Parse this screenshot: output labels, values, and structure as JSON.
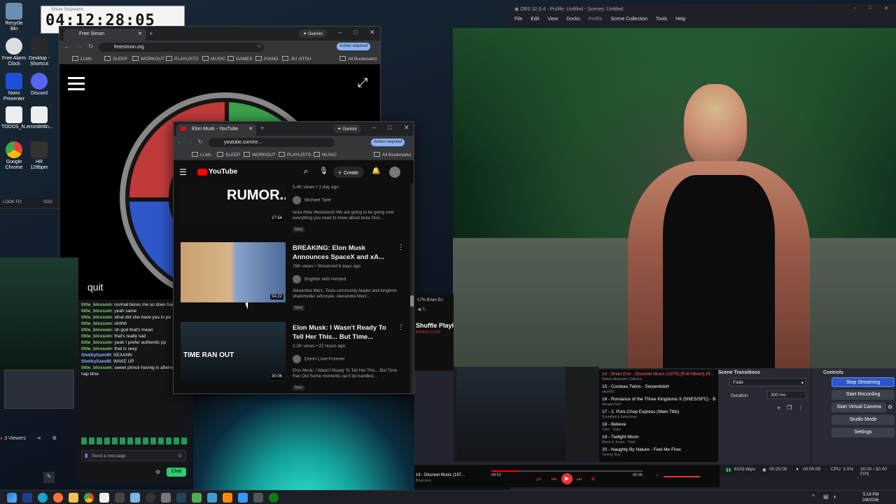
{
  "desktop": {
    "icons": [
      {
        "label": "Recycle Bin"
      },
      {
        "label": "Free Alarm Clock"
      },
      {
        "label": "Desktop - Shortcut"
      },
      {
        "label": "Nomi Presenter"
      },
      {
        "label": "Discord"
      },
      {
        "label": "TODOS_N..."
      },
      {
        "label": "errordrittin..."
      },
      {
        "label": "Google Chrome"
      },
      {
        "label": "HR 128bpm"
      }
    ],
    "clock_overlay": "04:12:28:05",
    "clock_window_title": "XNote Stopwatch"
  },
  "simon_window": {
    "tab_title": "Free Simon",
    "url": "freesimon.org",
    "gemini": "Gemini",
    "action_required": "Action required",
    "bookmarks": [
      "LLMs",
      "SLEEP",
      "WORKOUT",
      "PLAYLISTS",
      "MUSIC",
      "GAMES",
      "PIANO",
      "JIU JITSU"
    ],
    "all_bookmarks": "All Bookmarks",
    "quit_label": "quit"
  },
  "youtube_window": {
    "tab_title": "Elon Musk - YouTube",
    "url": "youtube.com/re...",
    "gemini": "Gemini",
    "action_required": "Action required",
    "bookmarks": [
      "LLMs",
      "SLEEP",
      "WORKOUT",
      "PLAYLISTS",
      "MUSIC"
    ],
    "all_bookmarks": "All Bookmarks",
    "logo": "YouTube",
    "create": "Create",
    "videos": [
      {
        "thumb_text": "RUMOR...",
        "meta": "5.4K views • 1 day ago",
        "channel": "Michael Tyler",
        "desc": "tesla #tsla #teslastock We are going to be going over everything you need to know about tesla Stoc...",
        "badge": "New",
        "duration": "27:54"
      },
      {
        "title": "BREAKING: Elon Musk Announces SpaceX and xA...",
        "meta": "76K views • Streamed 6 days ago",
        "channel": "Brighter with Herbert",
        "desc": "Alexandra Merz, Tesla community leader and longtime shareholder advocate. Alexandra Merz...",
        "badge": "New",
        "duration": "54:22"
      },
      {
        "title": "Elon Musk: I Wasn't Ready To Tell Her This... But Time...",
        "thumb_text": "TIME RAN OUT",
        "meta": "2.2K views • 22 hours ago",
        "channel": "Elonn-Love-Forever",
        "desc": "Elon Musk: I Wasn't Ready To Tell Her This... But Time Ran Out Some moments can't be handled...",
        "badge": "New",
        "duration": "30:06"
      }
    ]
  },
  "obs": {
    "title": "OBS 32.0.4 - Profile: Untitled - Scenes: Untitled",
    "menu": [
      "File",
      "Edit",
      "View",
      "Docks",
      "Profile",
      "Scene Collection",
      "Tools",
      "Help"
    ],
    "scene_transitions": {
      "title": "Scene Transitions",
      "transition": "Fade",
      "duration_label": "Duration",
      "duration": "300 ms"
    },
    "controls": {
      "title": "Controls",
      "buttons": [
        "Stop Streaming",
        "Start Recording",
        "Start Virtual Camera",
        "Studio Mode",
        "Settings"
      ]
    },
    "status": {
      "bitrate": "6153 kbps",
      "time": "00:25:08",
      "rec": "00:00:00",
      "cpu": "CPU: 3.0%",
      "fps": "30.00 / 30.00 FPS"
    }
  },
  "chat": {
    "lines": [
      {
        "user": "little_blossom",
        "text": "normal bores me so does hair"
      },
      {
        "user": "little_blossom",
        "text": "yeah same"
      },
      {
        "user": "little_blossom",
        "text": "what did she have you in pa"
      },
      {
        "user": "little_blossom",
        "text": "ohhhh"
      },
      {
        "user": "little_blossom",
        "text": "oh god that's mean"
      },
      {
        "user": "little_blossom",
        "text": "that's really sad"
      },
      {
        "user": "little_blossom",
        "text": "yeah I prefer authentic pp"
      },
      {
        "user": "little_blossom",
        "text": "that is sexy"
      },
      {
        "user": "ShelbySamiM",
        "text": "SEAANN"
      },
      {
        "user": "ShelbySamiM",
        "text": "WAKE UP"
      },
      {
        "user": "little_blossom",
        "text": "sweet prince having is afternoon nap time"
      }
    ],
    "viewers": "3 Viewers",
    "input_placeholder": "Send a message",
    "chat_button": "Chat"
  },
  "player": {
    "tab_title": "17% Brian En",
    "shuffle_label": "Shuffle Playl",
    "subtitle": "SONGS I LOVE",
    "queue": [
      {
        "title": "14 - Brian Eno - Discreet Music (1975) [Full Album] (R...",
        "sub": "Matias Alejandro Cabrera"
      },
      {
        "title": "15 - Cocteau Twins - Serpentskirt",
        "sub": "akum65"
      },
      {
        "title": "16 - Romance of the Three Kingdoms II (SNES/SFC) - B...",
        "sub": "Morgan Kell"
      },
      {
        "title": "17 - 2. Pork Chop Express (Main Title)",
        "sub": "Soundtrack Selections"
      },
      {
        "title": "18 - Believe",
        "sub": "Cher - Topic"
      },
      {
        "title": "19 - Twilight Moon",
        "sub": "Blank & Jones - Topic"
      },
      {
        "title": "20 - Naughty By Nature - Feel Me Flow",
        "sub": "Tommy Boy"
      }
    ],
    "now_playing": "14 - Discreet Music (197...",
    "now_artist": "Brian Eno",
    "elapsed": "09:53",
    "total": "55:05",
    "progress": 0.18
  },
  "tray": {
    "time": "5:18 PM",
    "date": "2/8/2026"
  }
}
